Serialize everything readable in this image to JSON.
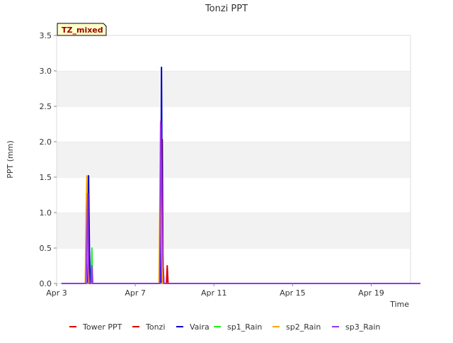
{
  "chart_data": {
    "type": "line",
    "title": "Tonzi PPT",
    "xlabel": "Time",
    "ylabel": "PPT (mm)",
    "annotation": "TZ_mixed",
    "xlim": [
      "2023-04-03",
      "2023-04-21"
    ],
    "ylim": [
      0,
      3.5
    ],
    "grid": "horizontal alternating bands",
    "x_ticks": [
      "Apr 3",
      "Apr 7",
      "Apr 11",
      "Apr 15",
      "Apr 19"
    ],
    "y_ticks": [
      "0.0",
      "0.5",
      "1.0",
      "1.5",
      "2.0",
      "2.5",
      "3.0",
      "3.5"
    ],
    "legend_position": "bottom",
    "colors": {
      "Tower PPT": "#dd0000",
      "Tonzi": "#dd0000",
      "Vaira": "#0000cc",
      "sp1_Rain": "#22ee22",
      "sp2_Rain": "#ffa500",
      "sp3_Rain": "#9933ee"
    },
    "series": [
      {
        "name": "Tower PPT",
        "points": [
          [
            "2023-04-03 06:00",
            0
          ],
          [
            "2023-04-21 12:00",
            0
          ]
        ]
      },
      {
        "name": "Tonzi",
        "points": [
          [
            "2023-04-03 06:00",
            0
          ],
          [
            "2023-04-08 08:00",
            0
          ],
          [
            "2023-04-08 09:00",
            2.03
          ],
          [
            "2023-04-08 10:00",
            0
          ],
          [
            "2023-04-08 14:00",
            0
          ],
          [
            "2023-04-08 15:00",
            0.25
          ],
          [
            "2023-04-08 16:00",
            0
          ],
          [
            "2023-04-21 12:00",
            0
          ]
        ]
      },
      {
        "name": "Vaira",
        "points": [
          [
            "2023-04-03 06:00",
            0
          ],
          [
            "2023-04-04 14:00",
            0
          ],
          [
            "2023-04-04 15:00",
            1.52
          ],
          [
            "2023-04-04 16:00",
            0.5
          ],
          [
            "2023-04-04 17:00",
            0
          ],
          [
            "2023-04-08 07:00",
            0
          ],
          [
            "2023-04-08 08:00",
            3.05
          ],
          [
            "2023-04-08 09:00",
            0.5
          ],
          [
            "2023-04-08 10:00",
            0.25
          ],
          [
            "2023-04-08 11:00",
            0
          ],
          [
            "2023-04-21 12:00",
            0
          ]
        ]
      },
      {
        "name": "sp1_Rain",
        "points": [
          [
            "2023-04-03 06:00",
            0
          ],
          [
            "2023-04-04 18:00",
            0
          ],
          [
            "2023-04-04 19:00",
            0.5
          ],
          [
            "2023-04-04 20:00",
            0
          ],
          [
            "2023-04-21 12:00",
            0
          ]
        ]
      },
      {
        "name": "sp2_Rain",
        "points": [
          [
            "2023-04-03 06:00",
            0
          ],
          [
            "2023-04-04 11:00",
            0
          ],
          [
            "2023-04-04 12:00",
            1.0
          ],
          [
            "2023-04-04 13:00",
            1.52
          ],
          [
            "2023-04-04 14:00",
            0.5
          ],
          [
            "2023-04-04 15:00",
            0
          ],
          [
            "2023-04-08 05:00",
            0
          ],
          [
            "2023-04-08 06:00",
            1.0
          ],
          [
            "2023-04-08 07:00",
            2.29
          ],
          [
            "2023-04-08 08:00",
            0.75
          ],
          [
            "2023-04-08 09:00",
            0
          ],
          [
            "2023-04-21 12:00",
            0
          ]
        ]
      },
      {
        "name": "sp3_Rain",
        "points": [
          [
            "2023-04-03 06:00",
            0
          ],
          [
            "2023-04-04 12:00",
            0
          ],
          [
            "2023-04-04 13:00",
            0.76
          ],
          [
            "2023-04-04 14:00",
            1.27
          ],
          [
            "2023-04-04 15:00",
            0.25
          ],
          [
            "2023-04-04 16:00",
            0
          ],
          [
            "2023-04-04 18:00",
            0
          ],
          [
            "2023-04-04 19:00",
            0.25
          ],
          [
            "2023-04-04 20:00",
            0
          ],
          [
            "2023-04-08 06:00",
            0
          ],
          [
            "2023-04-08 07:00",
            2.29
          ],
          [
            "2023-04-08 08:00",
            1.52
          ],
          [
            "2023-04-08 09:00",
            0.76
          ],
          [
            "2023-04-08 10:00",
            0.25
          ],
          [
            "2023-04-08 11:00",
            0
          ],
          [
            "2023-04-21 12:00",
            0
          ]
        ]
      }
    ]
  }
}
